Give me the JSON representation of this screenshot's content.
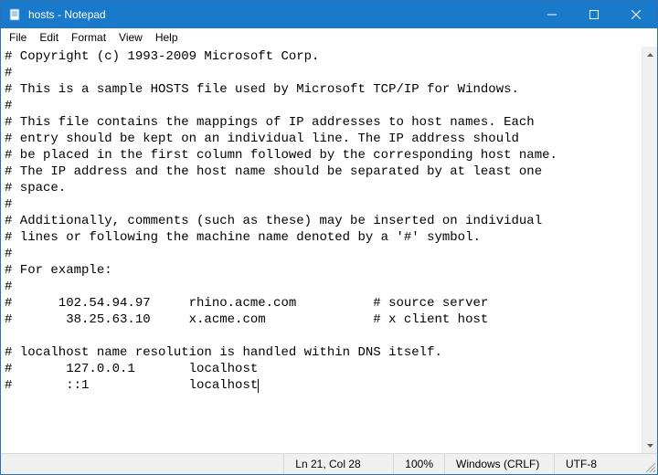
{
  "titlebar": {
    "title": "hosts - Notepad"
  },
  "menu": {
    "file": "File",
    "edit": "Edit",
    "format": "Format",
    "view": "View",
    "help": "Help"
  },
  "editor": {
    "content": "# Copyright (c) 1993-2009 Microsoft Corp.\n#\n# This is a sample HOSTS file used by Microsoft TCP/IP for Windows.\n#\n# This file contains the mappings of IP addresses to host names. Each\n# entry should be kept on an individual line. The IP address should\n# be placed in the first column followed by the corresponding host name.\n# The IP address and the host name should be separated by at least one\n# space.\n#\n# Additionally, comments (such as these) may be inserted on individual\n# lines or following the machine name denoted by a '#' symbol.\n#\n# For example:\n#\n#      102.54.94.97     rhino.acme.com          # source server\n#       38.25.63.10     x.acme.com              # x client host\n\n# localhost name resolution is handled within DNS itself.\n#\t127.0.0.1       localhost\n#\t::1             localhost"
  },
  "statusbar": {
    "position": "Ln 21, Col 28",
    "zoom": "100%",
    "eol": "Windows (CRLF)",
    "encoding": "UTF-8"
  }
}
